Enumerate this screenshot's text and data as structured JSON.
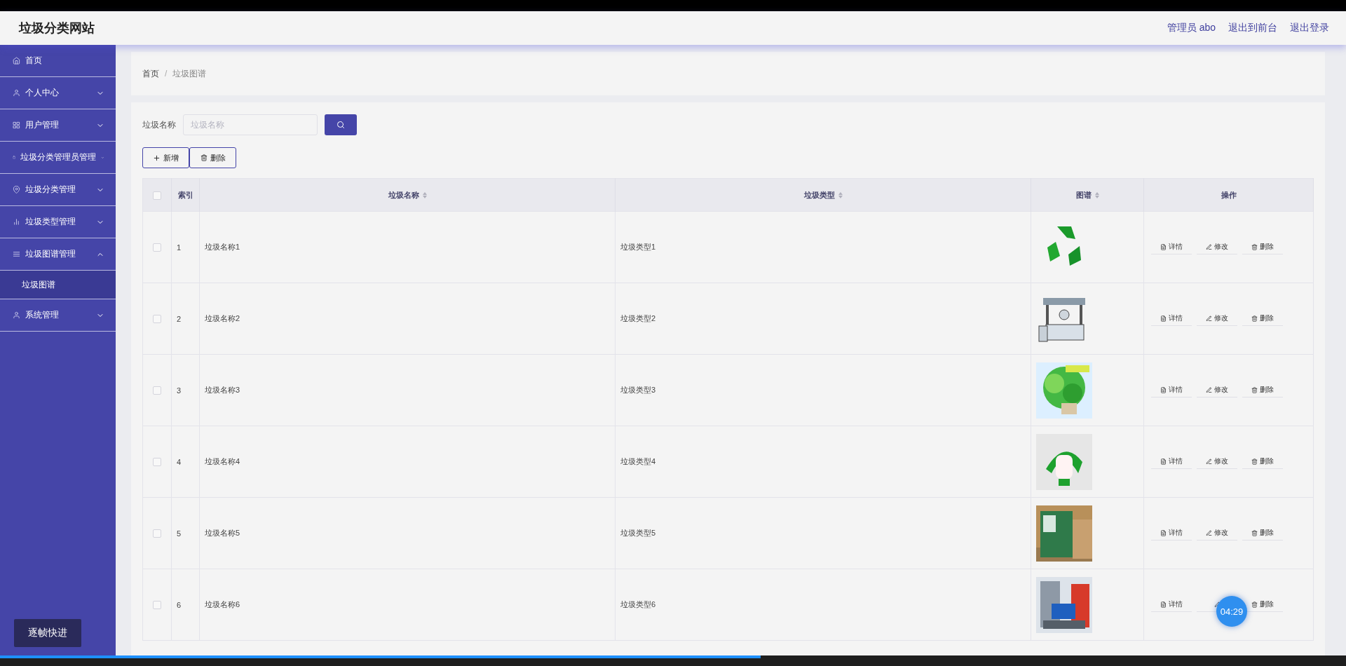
{
  "header": {
    "title": "垃圾分类网站",
    "links": [
      "管理员 abo",
      "退出到前台",
      "退出登录"
    ]
  },
  "sidebar": {
    "items": [
      {
        "label": "首页",
        "kind": "link"
      },
      {
        "label": "个人中心",
        "kind": "menu",
        "expanded": false
      },
      {
        "label": "用户管理",
        "kind": "menu",
        "expanded": false
      },
      {
        "label": "垃圾分类管理员管理",
        "kind": "menu",
        "expanded": false
      },
      {
        "label": "垃圾分类管理",
        "kind": "menu",
        "expanded": false
      },
      {
        "label": "垃圾类型管理",
        "kind": "menu",
        "expanded": false
      },
      {
        "label": "垃圾图谱管理",
        "kind": "menu",
        "expanded": true,
        "children": [
          {
            "label": "垃圾图谱",
            "selected": true
          }
        ]
      },
      {
        "label": "系统管理",
        "kind": "menu",
        "expanded": false
      }
    ]
  },
  "breadcrumb": {
    "separator": "/",
    "items": [
      "首页",
      "垃圾图谱"
    ]
  },
  "search": {
    "label": "垃圾名称",
    "placeholder": "垃圾名称"
  },
  "toolbar": [
    "新增",
    "删除"
  ],
  "table": {
    "all_checked": false,
    "columns": [
      {
        "label": "索引",
        "sortable": false
      },
      {
        "label": "垃圾名称",
        "sortable": true
      },
      {
        "label": "垃圾类型",
        "sortable": true
      },
      {
        "label": "图谱",
        "sortable": true
      },
      {
        "label": "操作",
        "sortable": false
      }
    ],
    "rows": [
      {
        "checked": false,
        "index": "1",
        "name": "垃圾名称1",
        "type": "垃圾类型1",
        "actions": [
          {
            "kind": "detail",
            "label": "详情"
          },
          {
            "kind": "edit",
            "label": "修改"
          },
          {
            "kind": "delete",
            "label": "删除"
          }
        ]
      },
      {
        "checked": false,
        "index": "2",
        "name": "垃圾名称2",
        "type": "垃圾类型2",
        "actions": [
          {
            "kind": "detail",
            "label": "详情"
          },
          {
            "kind": "edit",
            "label": "修改"
          },
          {
            "kind": "delete",
            "label": "删除"
          }
        ]
      },
      {
        "checked": false,
        "index": "3",
        "name": "垃圾名称3",
        "type": "垃圾类型3",
        "actions": [
          {
            "kind": "detail",
            "label": "详情"
          },
          {
            "kind": "edit",
            "label": "修改"
          },
          {
            "kind": "delete",
            "label": "删除"
          }
        ]
      },
      {
        "checked": false,
        "index": "4",
        "name": "垃圾名称4",
        "type": "垃圾类型4",
        "actions": [
          {
            "kind": "detail",
            "label": "详情"
          },
          {
            "kind": "edit",
            "label": "修改"
          },
          {
            "kind": "delete",
            "label": "删除"
          }
        ]
      },
      {
        "checked": false,
        "index": "5",
        "name": "垃圾名称5",
        "type": "垃圾类型5",
        "actions": [
          {
            "kind": "detail",
            "label": "详情"
          },
          {
            "kind": "edit",
            "label": "修改"
          },
          {
            "kind": "delete",
            "label": "删除"
          }
        ]
      },
      {
        "checked": false,
        "index": "6",
        "name": "垃圾名称6",
        "type": "垃圾类型6",
        "actions": [
          {
            "kind": "detail",
            "label": "详情"
          },
          {
            "kind": "edit"
          },
          {
            "kind": "delete",
            "label": "删除"
          }
        ]
      }
    ]
  },
  "player": {
    "step_button": "逐帧快进",
    "time": "04:29",
    "level": 0.565
  }
}
